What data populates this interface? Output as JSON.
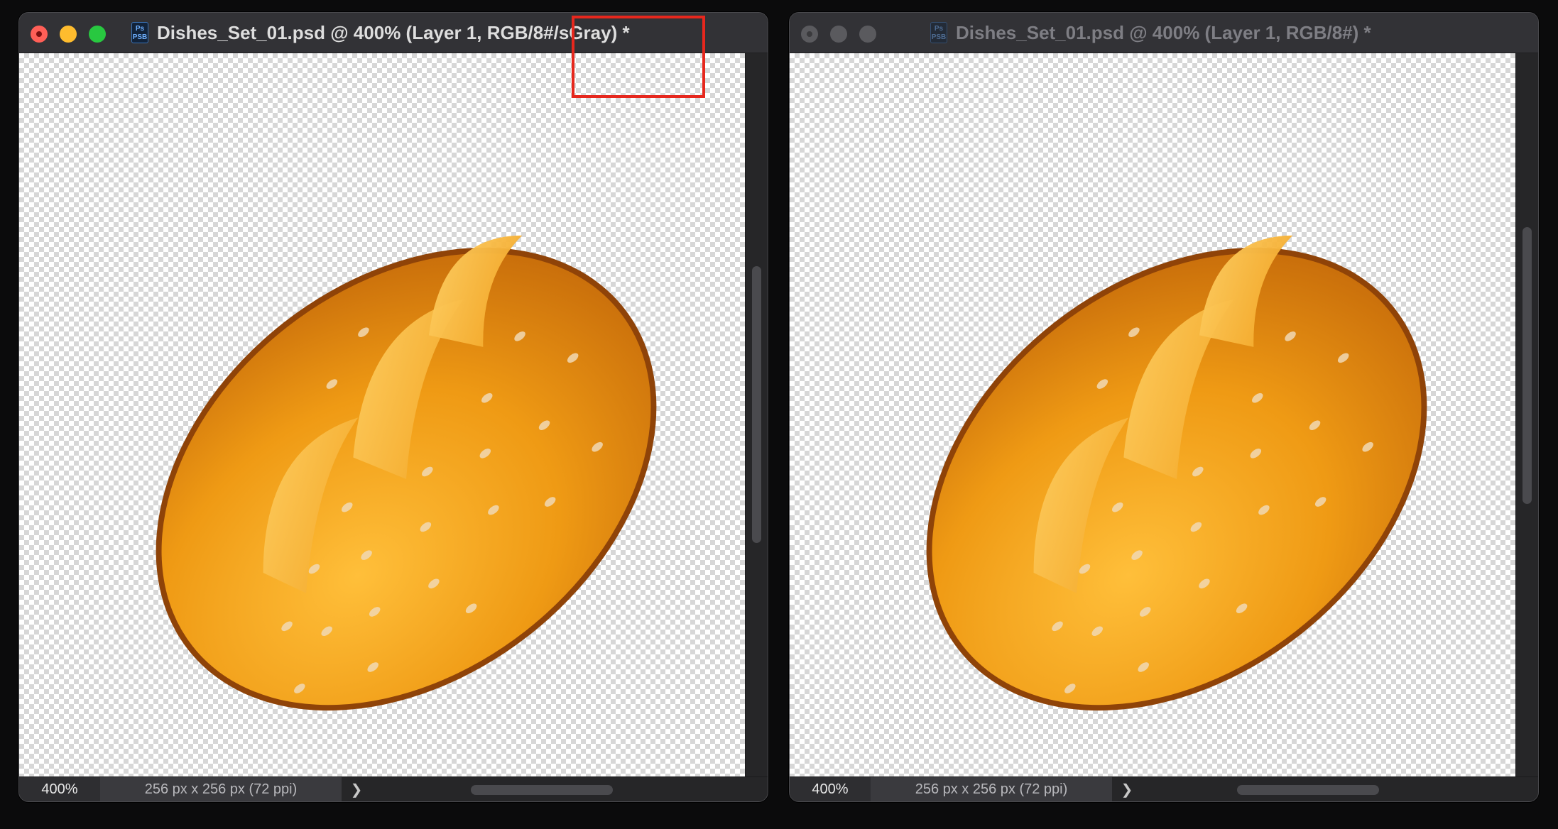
{
  "left_window": {
    "title": "Dishes_Set_01.psd @ 400% (Layer 1, RGB/8#/sGray) *",
    "app_icon": "photoshop-document-icon",
    "zoom": "400%",
    "doc_info": "256 px x 256 px (72 ppi)",
    "chevron": "❯",
    "window_controls": [
      "close",
      "minimize",
      "zoom"
    ]
  },
  "right_window": {
    "title": "Dishes_Set_01.psd @ 400% (Layer 1, RGB/8#) *",
    "app_icon": "photoshop-document-icon",
    "zoom": "400%",
    "doc_info": "256 px x 256 px (72 ppi)",
    "chevron": "❯",
    "window_controls": [
      "close",
      "minimize",
      "zoom"
    ]
  },
  "canvas_image": "bread-loaf",
  "colors": {
    "highlight": "#e6271d",
    "bread_dark": "#9a4b0a",
    "bread_mid": "#e98f12",
    "bread_light": "#ffbf3a",
    "seed": "#f1d9b5"
  }
}
